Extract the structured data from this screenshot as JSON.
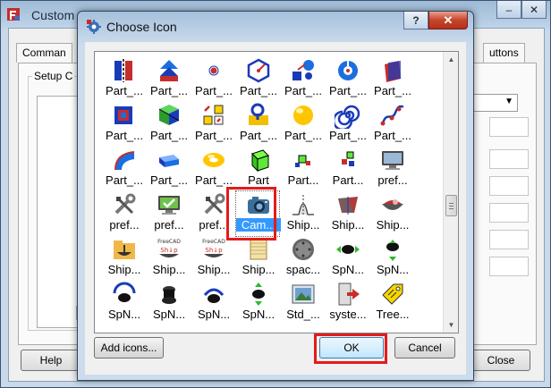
{
  "bg_window": {
    "title": "Custom",
    "tabs": [
      "Comman",
      "uttons"
    ],
    "group_label": "Setup C",
    "buttons": {
      "help": "Help",
      "close": "Close"
    }
  },
  "dialog": {
    "title": "Choose Icon",
    "help_caption": "?",
    "close_caption": "✕",
    "buttons": {
      "add_icons": "Add icons...",
      "ok": "OK",
      "cancel": "Cancel"
    },
    "icons": [
      [
        {
          "label": "Part_...",
          "icon": "mirror-icon"
        },
        {
          "label": "Part_...",
          "icon": "extrude-icon"
        },
        {
          "label": "Part_...",
          "icon": "point-icon"
        },
        {
          "label": "Part_...",
          "icon": "hexagon-icon"
        },
        {
          "label": "Part_...",
          "icon": "shapes-icon"
        },
        {
          "label": "Part_...",
          "icon": "revolve-icon"
        },
        {
          "label": "Part_...",
          "icon": "section-icon"
        }
      ],
      [
        {
          "label": "Part_...",
          "icon": "box-cut-icon"
        },
        {
          "label": "Part_...",
          "icon": "cube-group-icon"
        },
        {
          "label": "Part_...",
          "icon": "shape-builder-icon"
        },
        {
          "label": "Part_...",
          "icon": "pipe-icon"
        },
        {
          "label": "Part_...",
          "icon": "sphere-icon"
        },
        {
          "label": "Part_...",
          "icon": "spiral-icon"
        },
        {
          "label": "Part_...",
          "icon": "spline-icon"
        }
      ],
      [
        {
          "label": "Part_...",
          "icon": "sweep-icon"
        },
        {
          "label": "Part_...",
          "icon": "thickness-icon"
        },
        {
          "label": "Part_...",
          "icon": "torus-icon"
        },
        {
          "label": "Part",
          "icon": "green-cube-icon"
        },
        {
          "label": "Part...",
          "icon": "small-parts-icon"
        },
        {
          "label": "Part...",
          "icon": "small-parts-2-icon"
        },
        {
          "label": "pref...",
          "icon": "monitor-icon"
        }
      ],
      [
        {
          "label": "pref...",
          "icon": "tools-icon"
        },
        {
          "label": "pref...",
          "icon": "monitor-check-icon"
        },
        {
          "label": "pref...",
          "icon": "tools-2-icon"
        },
        {
          "label": "Cam...",
          "icon": "camera-icon"
        },
        {
          "label": "Ship...",
          "icon": "curve-icon"
        },
        {
          "label": "Ship...",
          "icon": "ship-hull-icon"
        },
        {
          "label": "Ship...",
          "icon": "ship-load-icon"
        }
      ],
      [
        {
          "label": "Ship...",
          "icon": "folder-ship-icon"
        },
        {
          "label": "Ship...",
          "icon": "freecad-ship-icon"
        },
        {
          "label": "Ship...",
          "icon": "freecad-ship-2-icon"
        },
        {
          "label": "Ship...",
          "icon": "scroll-icon"
        },
        {
          "label": "spac...",
          "icon": "spaceball-icon"
        },
        {
          "label": "SpN...",
          "icon": "spnav-left-right-icon"
        },
        {
          "label": "SpN...",
          "icon": "spnav-down-icon"
        }
      ],
      [
        {
          "label": "SpN...",
          "icon": "spnav-rotate-icon"
        },
        {
          "label": "SpN...",
          "icon": "spnav-push-icon"
        },
        {
          "label": "SpN...",
          "icon": "spnav-tilt-icon"
        },
        {
          "label": "SpN...",
          "icon": "spnav-updown-icon"
        },
        {
          "label": "Std_...",
          "icon": "image-icon"
        },
        {
          "label": "syste...",
          "icon": "exit-door-icon"
        },
        {
          "label": "Tree...",
          "icon": "tag-icon"
        }
      ]
    ],
    "title_fragment": "FreeCAD",
    "ship_text": "Sh↓p"
  }
}
